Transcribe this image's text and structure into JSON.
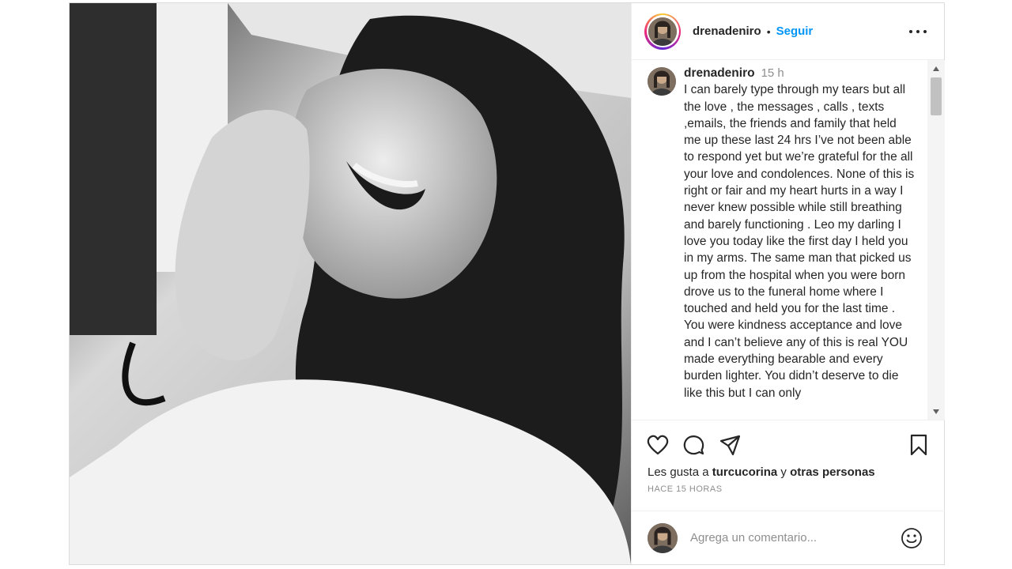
{
  "post": {
    "username": "drenadeniro",
    "follow_label": "Seguir",
    "dot": "•",
    "photo_icon": "post-photo",
    "more_icon": "more-options-icon"
  },
  "caption": {
    "username": "drenadeniro",
    "time": "15 h",
    "text": "I can barely type through my tears but all the love , the messages , calls , texts ,emails, the friends and family that held me up these last 24 hrs I’ve not been able to respond yet but we’re grateful for the all your love and condolences. None of this is right or fair and my heart hurts in a way I never knew possible while still breathing and barely functioning . Leo my darling I love you today like the first day I held you in my arms. The same man that picked us up from the hospital when you were born drove us to the funeral home where I touched and held you for the last time . You were kindness acceptance and love and I can’t believe any of this is real YOU made everything bearable and every burden lighter. You didn’t deserve to die like this but I can only"
  },
  "actions": {
    "icons": [
      "heart-icon",
      "comment-icon",
      "share-icon",
      "bookmark-icon"
    ]
  },
  "likes": {
    "prefix": "Les gusta a ",
    "user": "turcucorina",
    "connector": " y ",
    "others": "otras personas"
  },
  "time_ago": "HACE 15 HORAS",
  "comment_box": {
    "placeholder": "Agrega un comentario...",
    "emoji_icon": "emoji-icon"
  }
}
